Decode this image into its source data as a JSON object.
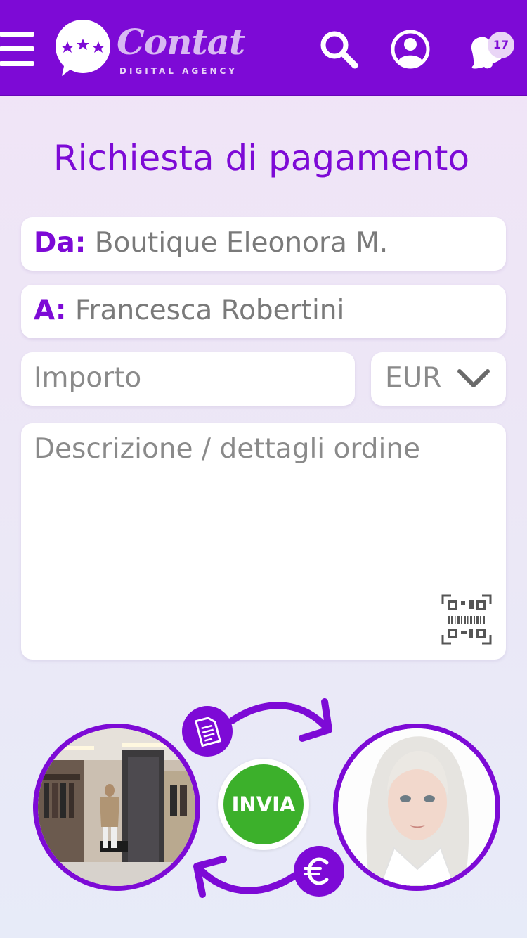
{
  "header": {
    "logo_word": "Contat",
    "logo_subtitle": "DIGITAL AGENCY",
    "notifications_count": "17"
  },
  "page": {
    "title": "Richiesta di pagamento"
  },
  "form": {
    "from_label": "Da:",
    "from_value": "Boutique Eleonora M.",
    "to_label": "A:",
    "to_value": "Francesca Robertini",
    "amount_placeholder": "Importo",
    "currency_value": "EUR",
    "description_placeholder": "Descrizione / dettagli ordine"
  },
  "actions": {
    "send_label": "INVIA"
  },
  "colors": {
    "brand": "#7d0ad6",
    "send": "#3cb02b"
  },
  "icons": {
    "menu": "hamburger-icon",
    "search": "search-icon",
    "profile": "user-icon",
    "notifications": "bell-icon",
    "scan": "qr-barcode-icon",
    "invoice": "document-icon",
    "payment": "euro-icon"
  }
}
